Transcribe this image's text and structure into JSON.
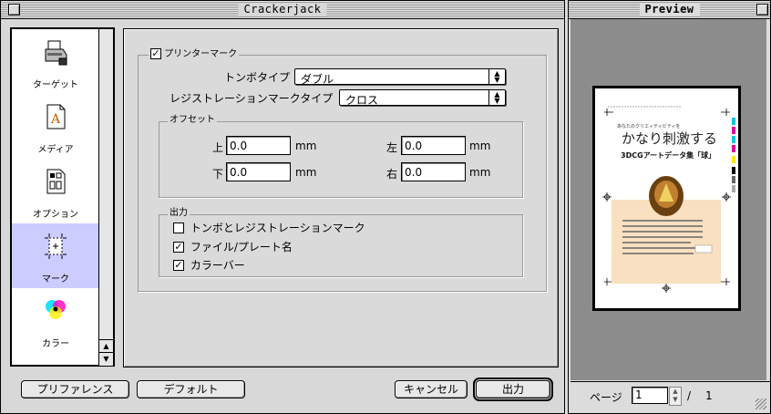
{
  "main_window": {
    "title": "Crackerjack"
  },
  "sidebar": {
    "items": [
      {
        "label": "ターゲット",
        "icon": "printer-icon"
      },
      {
        "label": "メディア",
        "icon": "document-a-icon"
      },
      {
        "label": "オプション",
        "icon": "options-calculator-icon"
      },
      {
        "label": "マーク",
        "icon": "crop-marks-icon"
      },
      {
        "label": "カラー",
        "icon": "color-circles-icon"
      }
    ],
    "selected": "マーク"
  },
  "printer_marks": {
    "checkbox_label": "プリンターマーク",
    "checked": true,
    "tombo_type_label": "トンボタイプ",
    "tombo_type_value": "ダブル",
    "registration_label": "レジストレーションマークタイプ",
    "registration_value": "クロス"
  },
  "offset": {
    "title": "オフセット",
    "top_label": "上",
    "top_value": "0.0",
    "left_label": "左",
    "left_value": "0.0",
    "bottom_label": "下",
    "bottom_value": "0.0",
    "right_label": "右",
    "right_value": "0.0",
    "unit": "mm"
  },
  "output": {
    "title": "出力",
    "options": [
      {
        "label": "トンボとレジストレーションマーク",
        "checked": false
      },
      {
        "label": "ファイル/プレート名",
        "checked": true
      },
      {
        "label": "カラーバー",
        "checked": true
      }
    ]
  },
  "buttons": {
    "preferences": "プリファレンス",
    "default": "デフォルト",
    "cancel": "キャンセル",
    "output": "出力"
  },
  "preview": {
    "title": "Preview",
    "page_label": "ページ",
    "page_value": "1",
    "separator": "/",
    "page_total": "1",
    "doc_headline_small": "あなたのクリエィティビティを",
    "doc_headline_large": "かなり刺激する",
    "doc_subtitle": "3DCGアートデータ集「球」",
    "colors": {
      "cream_box": "#f8e0c0",
      "cyan": "#00c8e0",
      "magenta": "#e000a0",
      "yellow": "#ffe800"
    }
  }
}
